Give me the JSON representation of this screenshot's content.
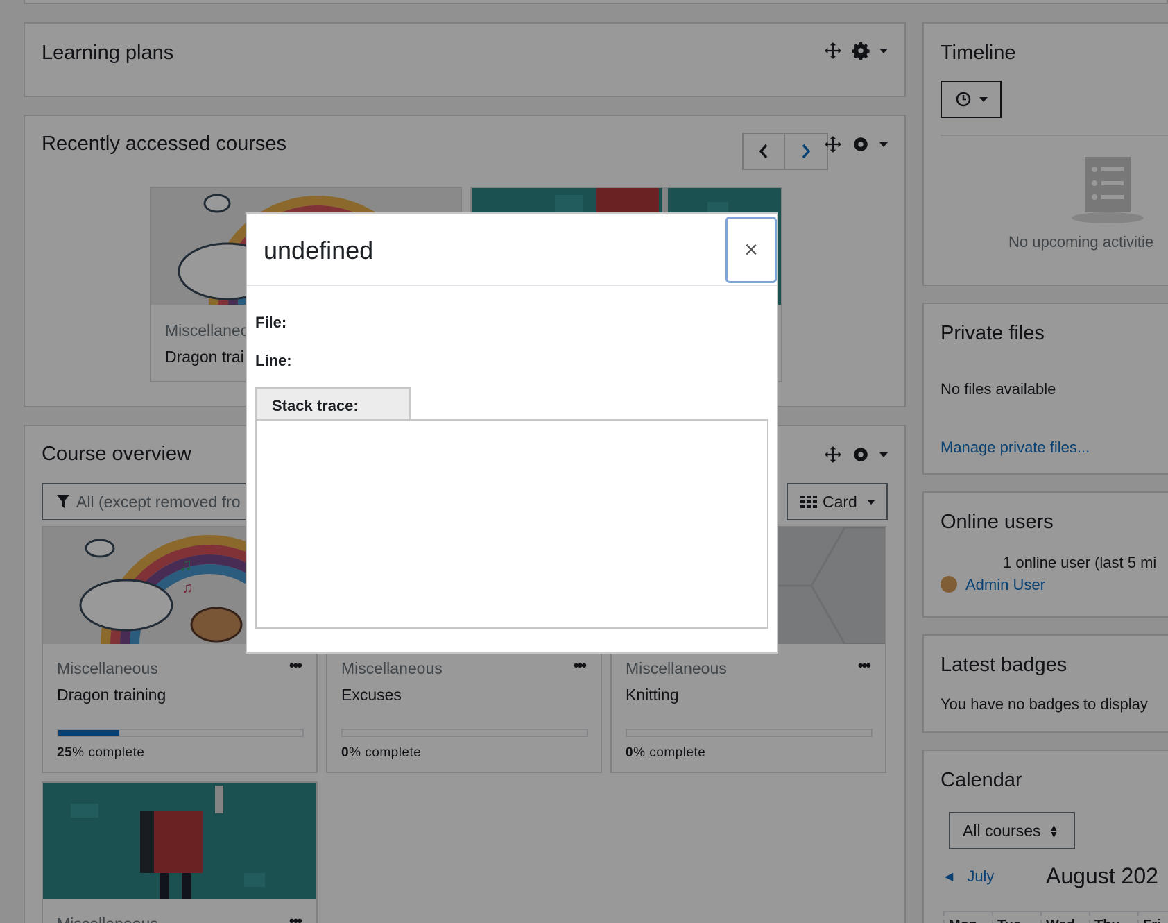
{
  "blocks": {
    "learning_plans": {
      "title": "Learning plans"
    },
    "recent": {
      "title": "Recently accessed courses"
    },
    "overview": {
      "title": "Course overview",
      "filter_label": "All (except removed fro",
      "view_label": "Card"
    }
  },
  "recent_cards": [
    {
      "category": "Miscellanec",
      "name": "Dragon trai"
    }
  ],
  "courses": [
    {
      "category": "Miscellaneous",
      "name": "Dragon training",
      "progress_pct": "25",
      "progress_suffix": "% complete",
      "progress": 0.25
    },
    {
      "category": "Miscellaneous",
      "name": "Excuses",
      "progress_pct": "0",
      "progress_suffix": "% complete",
      "progress": 0
    },
    {
      "category": "Miscellaneous",
      "name": "Knitting",
      "progress_pct": "0",
      "progress_suffix": "% complete",
      "progress": 0
    },
    {
      "category": "Miscellaneous",
      "name": ""
    }
  ],
  "sidebar": {
    "timeline": {
      "title": "Timeline",
      "empty": "No upcoming activitie"
    },
    "private_files": {
      "title": "Private files",
      "empty": "No files available",
      "manage": "Manage private files..."
    },
    "online_users": {
      "title": "Online users",
      "summary": "1 online user (last 5 mi",
      "user": "Admin User"
    },
    "badges": {
      "title": "Latest badges",
      "empty": "You have no badges to display"
    },
    "calendar": {
      "title": "Calendar",
      "filter": "All courses",
      "prev_month": "July",
      "current_month": "August 202",
      "weekdays": [
        "Mon",
        "Tue",
        "Wed",
        "Thu",
        "Fri"
      ]
    }
  },
  "modal": {
    "title": "undefined",
    "close_symbol": "×",
    "file_label": "File:",
    "line_label": "Line:",
    "stack_label": "Stack trace:"
  },
  "colors": {
    "link": "#0f6cbf",
    "progress": "#0f6cbf",
    "overlay": "rgba(0,0,0,0.4)"
  }
}
